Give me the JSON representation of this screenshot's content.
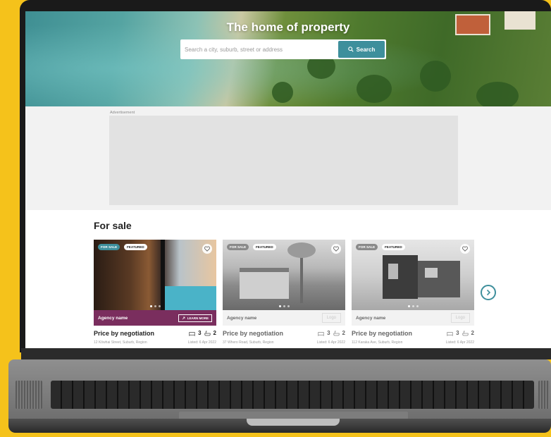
{
  "hero": {
    "title": "The home of property",
    "search_placeholder": "Search a city, suburb, street or address",
    "search_button": "Search"
  },
  "ad": {
    "label": "Advertisement"
  },
  "for_sale": {
    "title": "For sale",
    "cards": [
      {
        "badge_sale": "FOR SALE",
        "badge_featured": "FEATURED",
        "agency": "Agency name",
        "agency_action": "LEARN MORE",
        "price": "Price by negotiation",
        "beds": "3",
        "baths": "2",
        "address": "12 Kōwhai Street, Suburb, Region",
        "listed": "Listed: 6 Apr 2022"
      },
      {
        "badge_sale": "FOR SALE",
        "badge_featured": "FEATURED",
        "agency": "Agency name",
        "agency_action": "Logo",
        "price": "Price by negotiation",
        "beds": "3",
        "baths": "2",
        "address": "37 Whero Road, Suburb, Region",
        "listed": "Listed: 6 Apr 2022"
      },
      {
        "badge_sale": "FOR SALE",
        "badge_featured": "FEATURED",
        "agency": "Agency name",
        "agency_action": "Logo",
        "price": "Price by negotiation",
        "beds": "3",
        "baths": "2",
        "address": "112 Karaka Ave, Suburb, Region",
        "listed": "Listed: 6 Apr 2022"
      }
    ]
  },
  "colors": {
    "accent": "#3e8f9c",
    "agency_featured": "#7a2e5e",
    "background": "#f5c21b"
  },
  "icons": [
    "search-icon",
    "heart-icon",
    "bed-icon",
    "bath-icon",
    "chevron-right-icon",
    "external-link-icon"
  ]
}
